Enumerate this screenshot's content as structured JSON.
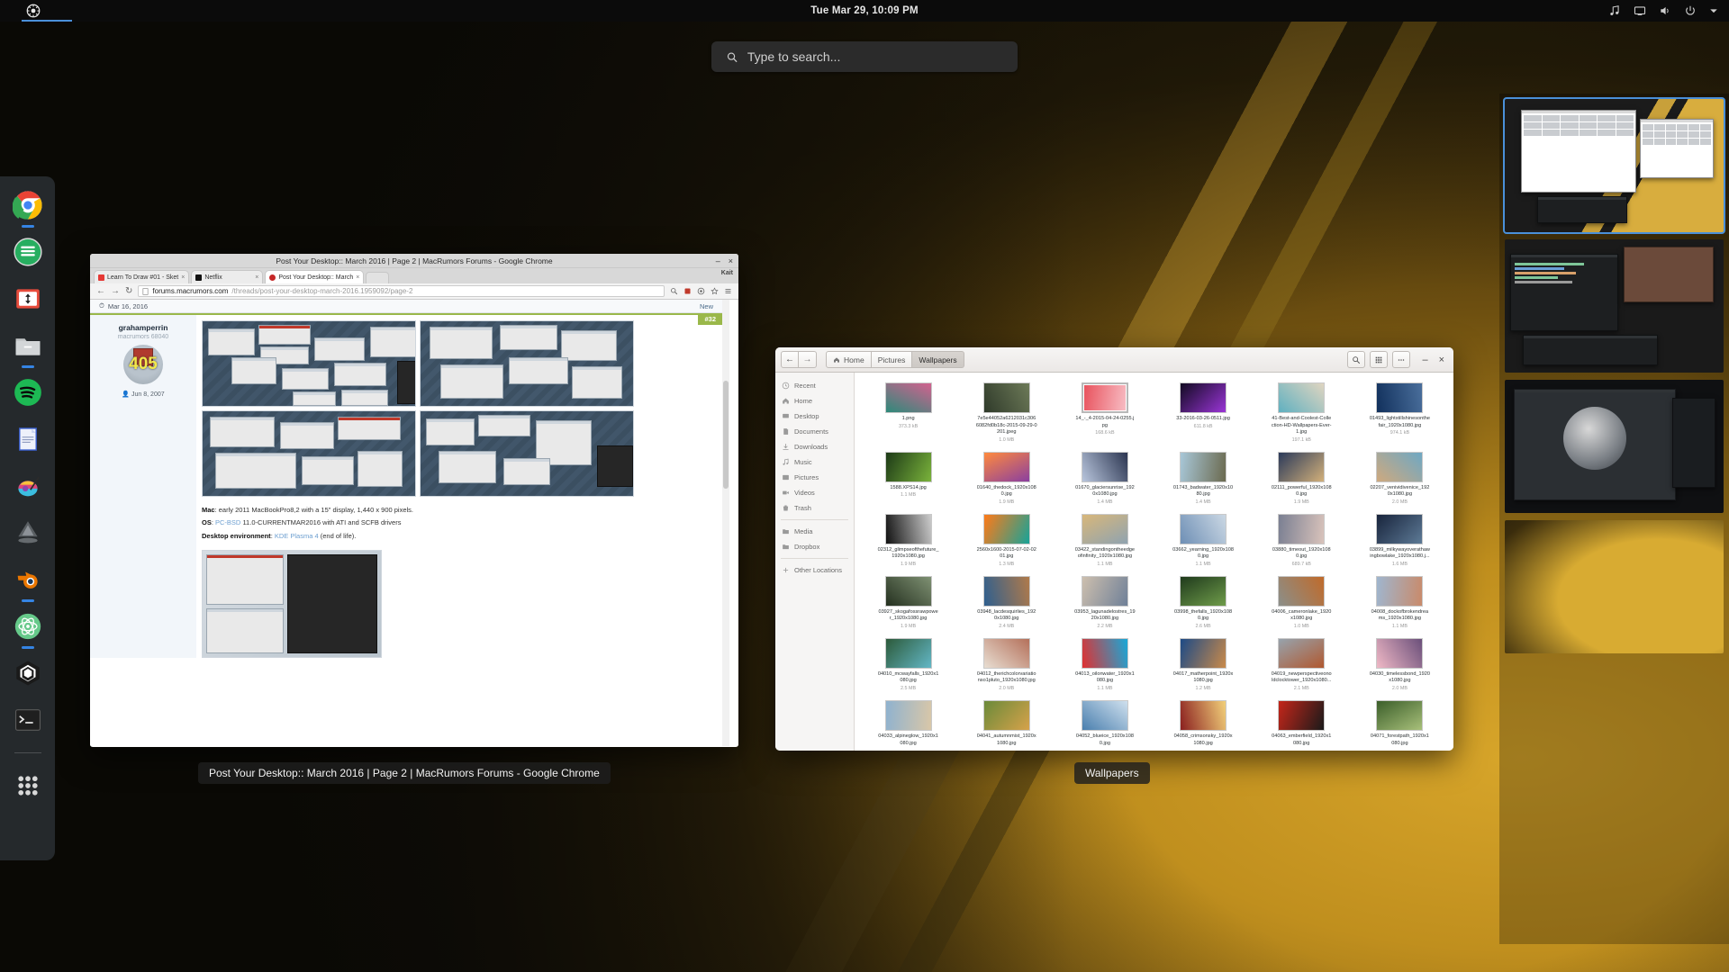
{
  "topbar": {
    "activities_label": "Activities",
    "clock": "Tue Mar 29, 10:09 PM",
    "icons": [
      "music-icon",
      "display-icon",
      "volume-icon",
      "power-icon",
      "chevron-down-icon"
    ]
  },
  "search": {
    "placeholder": "Type to search...",
    "value": ""
  },
  "dock": {
    "items": [
      {
        "name": "google-chrome",
        "label": "Google Chrome",
        "running": true
      },
      {
        "name": "green-app",
        "label": "Files Manager",
        "running": false
      },
      {
        "name": "transfer-app",
        "label": "Transfer Utility",
        "running": false
      },
      {
        "name": "nautilus-files",
        "label": "Files",
        "running": true
      },
      {
        "name": "spotify",
        "label": "Spotify",
        "running": false
      },
      {
        "name": "libreoffice-writer",
        "label": "LibreOffice Writer",
        "running": false
      },
      {
        "name": "krita",
        "label": "Krita",
        "running": false
      },
      {
        "name": "inkscape",
        "label": "Inkscape",
        "running": false
      },
      {
        "name": "blender",
        "label": "Blender",
        "running": true
      },
      {
        "name": "atom-editor",
        "label": "Atom",
        "running": true
      },
      {
        "name": "unity",
        "label": "Unity",
        "running": false
      },
      {
        "name": "terminal",
        "label": "Terminal",
        "running": false
      },
      {
        "name": "show-applications",
        "label": "Show Applications",
        "running": false
      }
    ]
  },
  "chrome": {
    "window_title": "Post Your Desktop:: March 2016 | Page 2 | MacRumors Forums - Google Chrome",
    "taskbar_label": "Post Your Desktop:: March 2016 | Page 2 | MacRumors Forums - Google Chrome",
    "window_buttons": {
      "minimize": "–",
      "close": "×"
    },
    "tabs": [
      {
        "title": "Learn To Draw #01 - Sket",
        "active": false,
        "favicon_color": "#e53935"
      },
      {
        "title": "Netflix",
        "active": false,
        "favicon_color": "#111111"
      },
      {
        "title": "Post Your Desktop:: March",
        "active": true,
        "favicon_color": "#c62828"
      }
    ],
    "new_tab_label": "+",
    "menu_label": "⋮",
    "profile_label": "Kait",
    "url_domain": "forums.macrumors.com",
    "url_rest": "/threads/post-your-desktop-march-2016.1959092/page-2",
    "nav": {
      "back": "←",
      "forward": "→",
      "reload": "↻"
    },
    "omnibox_icons": [
      "zoom-icon",
      "extension-icon",
      "adblock-icon",
      "star-icon",
      "menu-icon"
    ],
    "post": {
      "date": "Mar 16, 2016",
      "new_label": "New",
      "post_number": "#32",
      "author": "grahamperrin",
      "rank": "macrumors 68040",
      "avatar_number": "405",
      "join_date": "Jun 8, 2007",
      "spec_lines": [
        {
          "label": "Mac",
          "value": ": early 2011 MacBookPro8,2 with a 15\" display, 1,440 x 900 pixels."
        },
        {
          "label": "OS",
          "link": "PC-BSD",
          "value": " 11.0-CURRENTMAR2016 with ATI and SCFB drivers"
        },
        {
          "label": "Desktop environment",
          "link": "KDE Plasma 4",
          "value": " (end of life)."
        }
      ]
    }
  },
  "files": {
    "window_title": "Wallpapers",
    "taskbar_label": "Wallpapers",
    "breadcrumbs": [
      {
        "label": "Home",
        "icon": "home-icon",
        "active": false
      },
      {
        "label": "Pictures",
        "icon": "",
        "active": false
      },
      {
        "label": "Wallpapers",
        "icon": "",
        "active": true
      }
    ],
    "toolbar_icons": [
      "search-icon",
      "grid-view-icon",
      "more-options-icon"
    ],
    "window_buttons": {
      "minimize": "–",
      "close": "×"
    },
    "sidebar": [
      {
        "label": "Recent",
        "icon": "clock-icon"
      },
      {
        "label": "Home",
        "icon": "home-icon"
      },
      {
        "label": "Desktop",
        "icon": "desktop-icon"
      },
      {
        "label": "Documents",
        "icon": "document-icon"
      },
      {
        "label": "Downloads",
        "icon": "download-icon"
      },
      {
        "label": "Music",
        "icon": "music-icon"
      },
      {
        "label": "Pictures",
        "icon": "picture-icon"
      },
      {
        "label": "Videos",
        "icon": "video-icon"
      },
      {
        "label": "Trash",
        "icon": "trash-icon"
      },
      {
        "label": "Media",
        "icon": "folder-icon",
        "group": 2
      },
      {
        "label": "Dropbox",
        "icon": "folder-icon",
        "group": 2
      },
      {
        "label": "Other Locations",
        "icon": "plus-icon",
        "group": 3
      }
    ],
    "items": [
      {
        "name": "1.png",
        "size": "373.3 kB",
        "c1": "#2d8a7a",
        "c2": "#d3618f",
        "selected": false
      },
      {
        "name": "7e5e44052a6212031c3066082fd0b18c-2015-09-29-0201.jpeg",
        "size": "1.0 MB",
        "c1": "#2f3a2a",
        "c2": "#6d7a58",
        "selected": false
      },
      {
        "name": "14_-_4-2015-04-24-0255.jpg",
        "size": "168.6 kB",
        "c1": "#e8505b",
        "c2": "#f8bfc6",
        "selected": true
      },
      {
        "name": "33-2016-03-26-0511.jpg",
        "size": "611.8 kB",
        "c1": "#120a22",
        "c2": "#9a35d6",
        "selected": false
      },
      {
        "name": "41-Best-and-Coolest-Collection-HD-Wallpapers-Ever-1.jpg",
        "size": "197.1 kB",
        "c1": "#5fb0c0",
        "c2": "#e0d5c0",
        "selected": false
      },
      {
        "name": "01493_lightstillshinesonthefair_1920x1080.jpg",
        "size": "974.1 kB",
        "c1": "#11305c",
        "c2": "#4a6f9c",
        "selected": false
      },
      {
        "name": "1588.XPS14.jpg",
        "size": "1.1 MB",
        "c1": "#1d3a17",
        "c2": "#7ab33b",
        "selected": false
      },
      {
        "name": "01640_thedock_1920x1080.jpg",
        "size": "1.9 MB",
        "c1": "#ff8a3d",
        "c2": "#8a3fa0",
        "selected": false
      },
      {
        "name": "01670_glaciersunrise_1920x1080.jpg",
        "size": "1.4 MB",
        "c1": "#b9c6dd",
        "c2": "#2b3550",
        "selected": false
      },
      {
        "name": "01743_badwater_1920x1080.jpg",
        "size": "1.4 MB",
        "c1": "#a8c7d8",
        "c2": "#6b6a4f",
        "selected": false
      },
      {
        "name": "02111_powerful_1920x1080.jpg",
        "size": "1.9 MB",
        "c1": "#2b3a5a",
        "c2": "#d2b07a",
        "selected": false
      },
      {
        "name": "02207_venividivenice_1920x1080.jpg",
        "size": "2.0 MB",
        "c1": "#cfa97e",
        "c2": "#6ea8c4",
        "selected": false
      },
      {
        "name": "02312_glimpseofthefuture_1920x1080.jpg",
        "size": "1.9 MB",
        "c1": "#111111",
        "c2": "#cccccc",
        "selected": false
      },
      {
        "name": "2560x1600-2015-07-02-0201.jpg",
        "size": "1.3 MB",
        "c1": "#ff7a18",
        "c2": "#17a398",
        "selected": false
      },
      {
        "name": "03422_standingontheedgeofinfinity_1920x1080.jpg",
        "size": "1.1 MB",
        "c1": "#d8b77a",
        "c2": "#8fa3b0",
        "selected": false
      },
      {
        "name": "03662_yearning_1920x1080.jpg",
        "size": "1.1 MB",
        "c1": "#6e8fb5",
        "c2": "#cbd8e4",
        "selected": false
      },
      {
        "name": "03880_timeout_1920x1080.jpg",
        "size": "689.7 kB",
        "c1": "#7a7f92",
        "c2": "#d9c3bb",
        "selected": false
      },
      {
        "name": "03899_milkywayoverathawingbowlake_1920x1080.j...",
        "size": "1.6 MB",
        "c1": "#18243c",
        "c2": "#5d7a96",
        "selected": false
      },
      {
        "name": "03927_skogafossrawpower_1920x1080.jpg",
        "size": "1.9 MB",
        "c1": "#24301f",
        "c2": "#7f9173",
        "selected": false
      },
      {
        "name": "03948_lacdesquirlies_1920x1080.jpg",
        "size": "2.4 MB",
        "c1": "#2e5f8f",
        "c2": "#b07a4a",
        "selected": false
      },
      {
        "name": "03953_lagunadelostres_1920x1080.jpg",
        "size": "2.2 MB",
        "c1": "#cdbfae",
        "c2": "#6f8098",
        "selected": false
      },
      {
        "name": "03998_thefalls_1920x1080.jpg",
        "size": "2.6 MB",
        "c1": "#1f3a1c",
        "c2": "#6f9c4a",
        "selected": false
      },
      {
        "name": "04006_cameronlake_1920x1080.jpg",
        "size": "1.0 MB",
        "c1": "#8b8f8a",
        "c2": "#c06a2a",
        "selected": false
      },
      {
        "name": "04008_dockofbrokendreams_1920x1080.jpg",
        "size": "1.1 MB",
        "c1": "#9fb6cf",
        "c2": "#c98a6a",
        "selected": false
      },
      {
        "name": "04010_mcwayfalls_1920x1080.jpg",
        "size": "2.5 MB",
        "c1": "#2c5a3a",
        "c2": "#63b7c6",
        "selected": false
      },
      {
        "name": "04012_therichcolorvariationso1pluto_1920x1080.jpg",
        "size": "2.0 MB",
        "c1": "#e8ded2",
        "c2": "#b4705a",
        "selected": false
      },
      {
        "name": "04013_oilonwater_1920x1080.jpg",
        "size": "1.1 MB",
        "c1": "#e03030",
        "c2": "#18a8d8",
        "selected": false
      },
      {
        "name": "04017_matherpoint_1920x1080.jpg",
        "size": "1.2 MB",
        "c1": "#1d4a86",
        "c2": "#c98a4a",
        "selected": false
      },
      {
        "name": "04019_newperspectiveonoldclocktower_1920x1080...",
        "size": "2.1 MB",
        "c1": "#97a3ad",
        "c2": "#b0582f",
        "selected": false
      },
      {
        "name": "04030_timelessbond_1920x1080.jpg",
        "size": "2.0 MB",
        "c1": "#f0b9c6",
        "c2": "#6a4f7a",
        "selected": false
      },
      {
        "name": "04033_alpineglow_1920x1080.jpg",
        "size": "",
        "c1": "#8fb2cf",
        "c2": "#d9c7a8",
        "selected": false
      },
      {
        "name": "04041_autumnmist_1920x1080.jpg",
        "size": "",
        "c1": "#6b8a3a",
        "c2": "#d6a24a",
        "selected": false
      },
      {
        "name": "04052_blueice_1920x1080.jpg",
        "size": "",
        "c1": "#4a7fae",
        "c2": "#cfe0ee",
        "selected": false
      },
      {
        "name": "04058_crimsonsky_1920x1080.jpg",
        "size": "",
        "c1": "#8a1f1f",
        "c2": "#f2d07a",
        "selected": false
      },
      {
        "name": "04063_emberfield_1920x1080.jpg",
        "size": "",
        "c1": "#c4261a",
        "c2": "#1a1a1a",
        "selected": false
      },
      {
        "name": "04071_forestpath_1920x1080.jpg",
        "size": "",
        "c1": "#3b5e2a",
        "c2": "#a8c07a",
        "selected": false
      }
    ]
  },
  "workspaces": [
    {
      "index": 1,
      "active": true,
      "label": "Workspace 1"
    },
    {
      "index": 2,
      "active": false,
      "label": "Workspace 2"
    },
    {
      "index": 3,
      "active": false,
      "label": "Workspace 3"
    },
    {
      "index": 4,
      "active": false,
      "label": "Workspace 4"
    }
  ],
  "colors": {
    "accent": "#4a90d9",
    "badge_green": "#9ab84a",
    "topbar_bg": "#0b0b0b",
    "dock_bg": "#282c30"
  }
}
